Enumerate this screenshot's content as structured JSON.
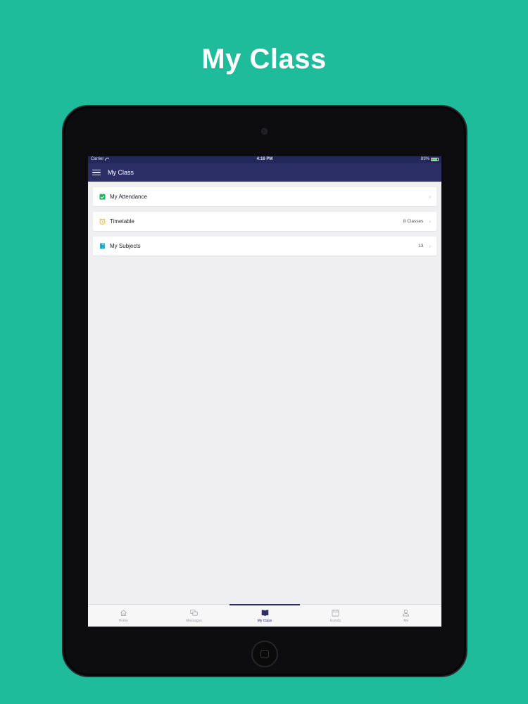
{
  "promo": {
    "title": "My Class"
  },
  "status_bar": {
    "carrier": "Carrier",
    "time": "4:16 PM",
    "battery": "83%",
    "battery_level": 0.83
  },
  "nav": {
    "title": "My Class"
  },
  "list": [
    {
      "label": "My Attendance",
      "detail": "",
      "icon": "attendance-check-icon",
      "icon_color": "#27ae60"
    },
    {
      "label": "Timetable",
      "detail": "8 Classes",
      "icon": "alarm-clock-icon",
      "icon_color": "#f5b82e"
    },
    {
      "label": "My Subjects",
      "detail": "13",
      "icon": "book-icon",
      "icon_color": "#2aa8c8"
    }
  ],
  "tabs": [
    {
      "label": "Home",
      "icon": "home-icon",
      "active": false
    },
    {
      "label": "Messages",
      "icon": "messages-icon",
      "active": false
    },
    {
      "label": "My Class",
      "icon": "open-book-icon",
      "active": true
    },
    {
      "label": "Events",
      "icon": "calendar-icon",
      "active": false
    },
    {
      "label": "Me",
      "icon": "user-icon",
      "active": false
    }
  ],
  "colors": {
    "background": "#1fbc9c",
    "nav": "#2b2f66",
    "status": "#23285a"
  }
}
